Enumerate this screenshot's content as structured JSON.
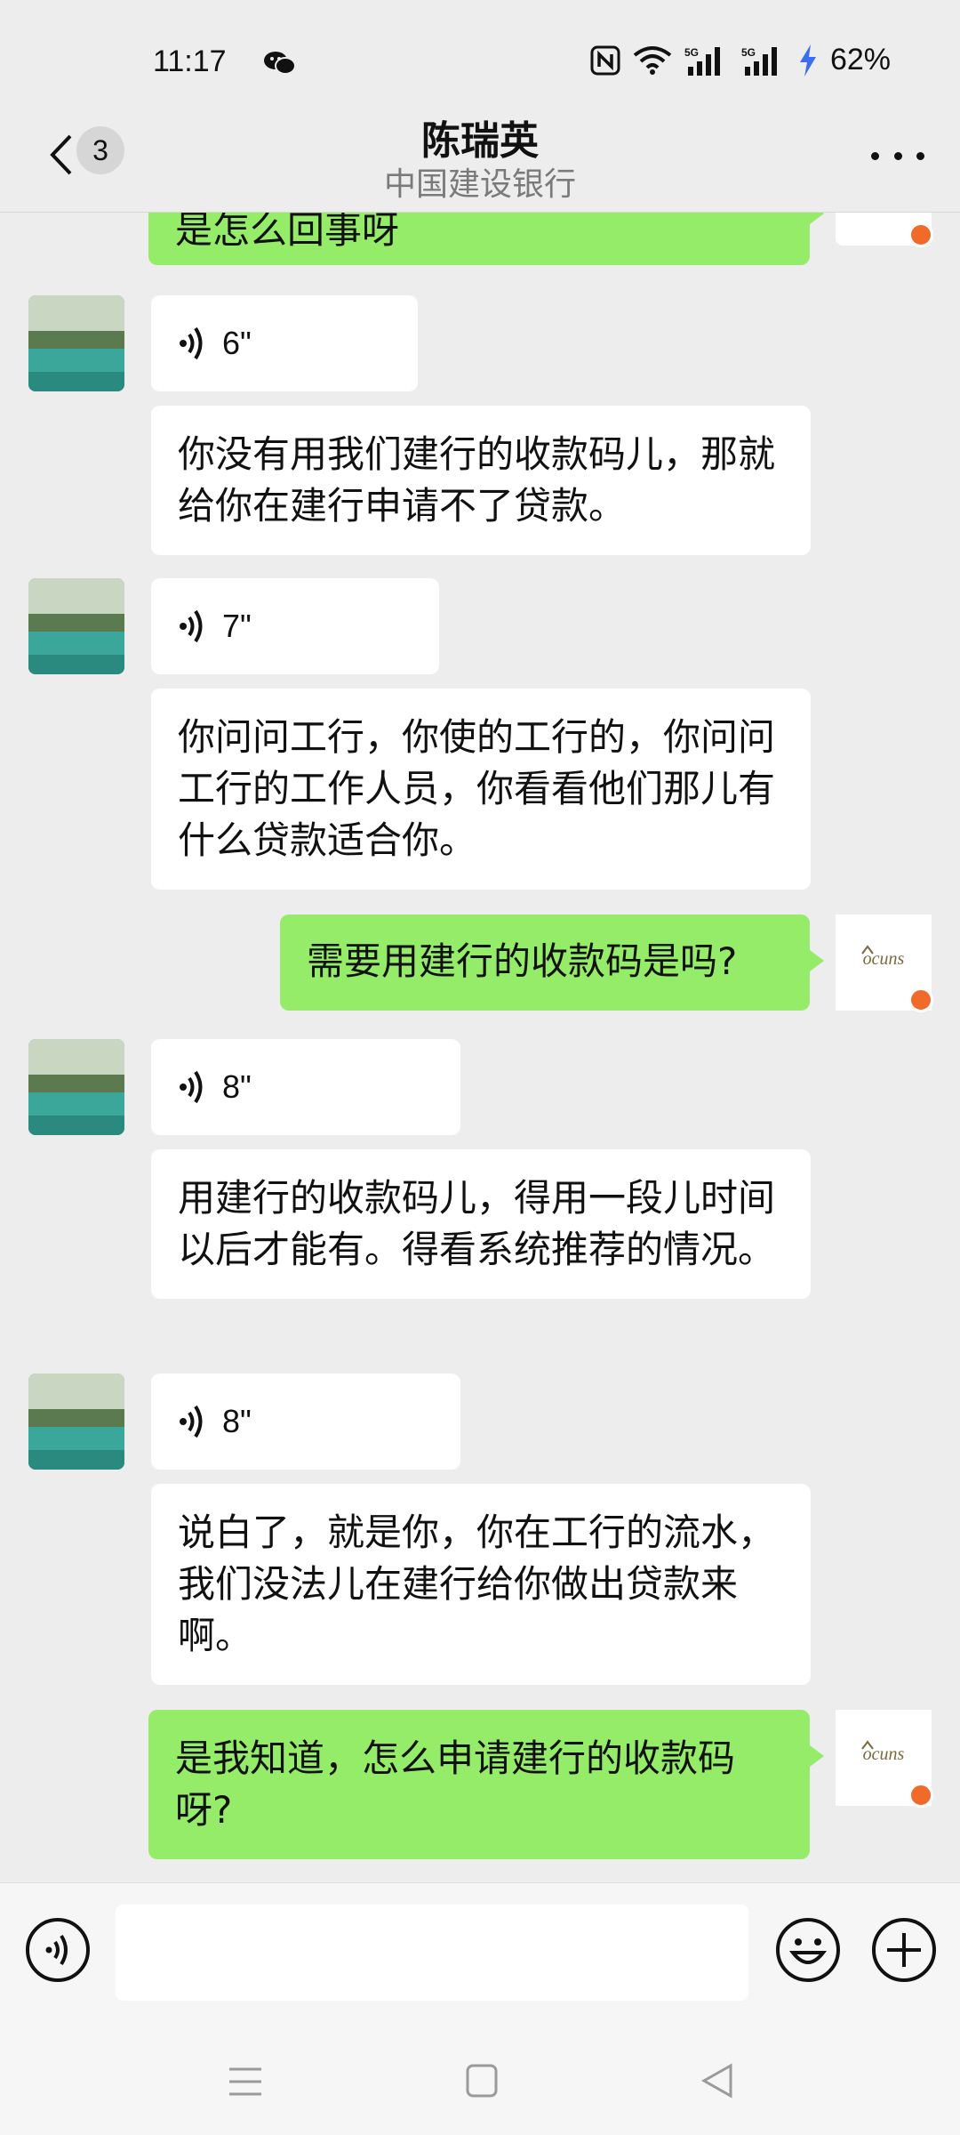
{
  "status": {
    "time": "11:17",
    "battery": "62%"
  },
  "header": {
    "unread": "3",
    "title": "陈瑞英",
    "subtitle": "中国建设银行"
  },
  "messages": {
    "m0": "是怎么回事呀",
    "v1": "6\"",
    "m1": "你没有用我们建行的收款码儿，那就给你在建行申请不了贷款。",
    "v2": "7\"",
    "m2": "你问问工行，你使的工行的，你问问工行的工作人员，你看看他们那儿有什么贷款适合你。",
    "m3": "需要用建行的收款码是吗?",
    "v3": "8\"",
    "m4": "用建行的收款码儿，得用一段儿时间以后才能有。得看系统推荐的情况。",
    "v4": "8\"",
    "m5": "说白了，就是你，你在工行的流水，我们没法儿在建行给你做出贷款来啊。",
    "m6": "是我知道，怎么申请建行的收款码呀?"
  },
  "avatar_logo_text": "ocuns"
}
